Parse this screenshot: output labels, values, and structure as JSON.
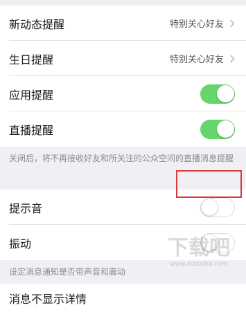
{
  "rows": [
    {
      "label": "新动态提醒",
      "value": "特别关心好友",
      "type": "link"
    },
    {
      "label": "生日提醒",
      "value": "特别关心好友",
      "type": "link"
    },
    {
      "label": "应用提醒",
      "type": "toggle",
      "state": "on"
    },
    {
      "label": "直播提醒",
      "type": "toggle",
      "state": "on"
    },
    {
      "label": "提示音",
      "type": "toggle",
      "state": "off"
    },
    {
      "label": "振动",
      "type": "toggle",
      "state": "off"
    },
    {
      "label": "消息不显示详情",
      "type": "partial"
    }
  ],
  "notes": {
    "live_note": "关闭后，将不再接收好友和所关注的公众空间的直播消息提醒",
    "sound_note": "设定消息通知是否带声音和震动"
  },
  "watermark": {
    "site": "下载吧",
    "url": "www.xiazaiba.com"
  },
  "colors": {
    "toggle_on": "#64d66a",
    "highlight": "#d83a3a",
    "background": "#efeff4"
  }
}
